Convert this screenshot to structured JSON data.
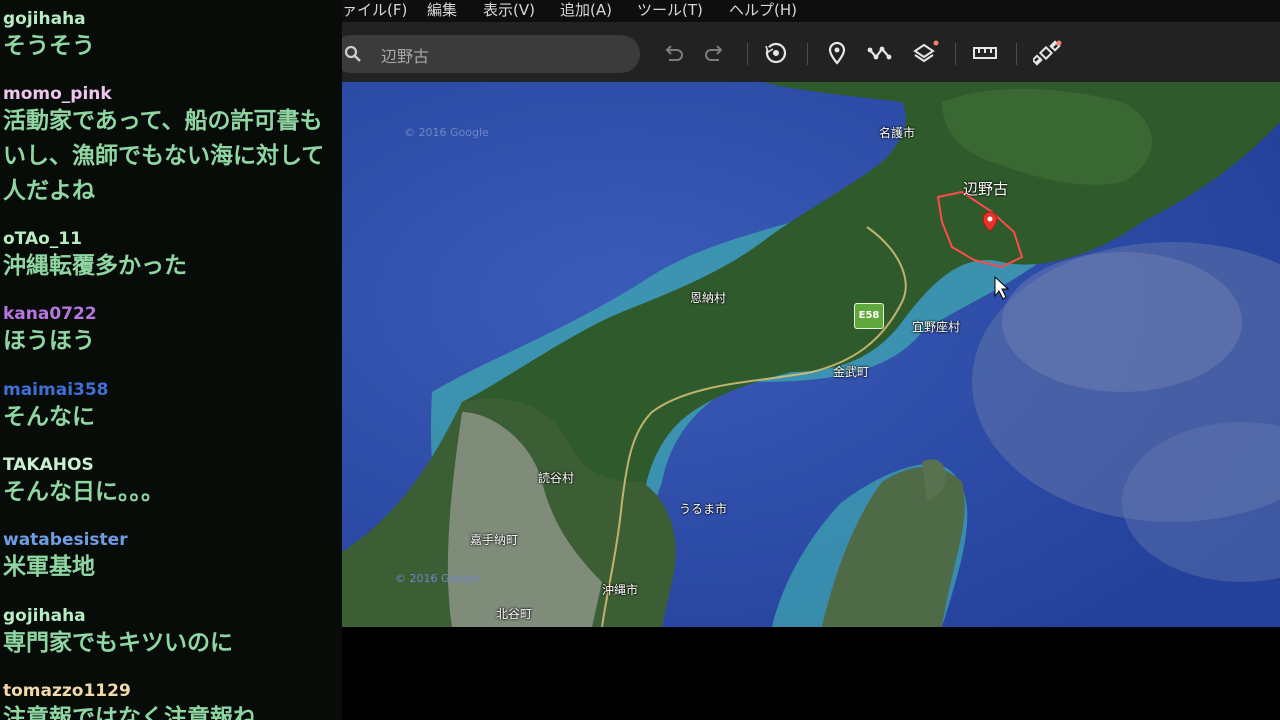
{
  "chat": {
    "messages": [
      {
        "user": "gojihaha",
        "user_color": "#b7ecc2",
        "lines": [
          "そうそう"
        ]
      },
      {
        "user": "momo_pink",
        "user_color": "#f0c6f0",
        "lines": [
          "活動家であって、船の許可書も",
          "いし、漁師でもない海に対して",
          "人だよね"
        ]
      },
      {
        "user": "oTAo_11",
        "user_color": "#b7ecc2",
        "lines": [
          "沖縄転覆多かった"
        ]
      },
      {
        "user": "kana0722",
        "user_color": "#b776e0",
        "lines": [
          "ほうほう"
        ]
      },
      {
        "user": "maimai358",
        "user_color": "#3f6fd6",
        "lines": [
          "そんなに"
        ]
      },
      {
        "user": "TAKAHOS",
        "user_color": "#c9f0d3",
        "lines": [
          "そんな日に。。。"
        ]
      },
      {
        "user": "watabesister",
        "user_color": "#6f9ce3",
        "lines": [
          "米軍基地"
        ]
      },
      {
        "user": "gojihaha",
        "user_color": "#b7ecc2",
        "lines": [
          "専門家でもキツいのに"
        ]
      },
      {
        "user": "tomazzo1129",
        "user_color": "#f1d9ab",
        "lines": [
          "注意報ではなく注意報ね"
        ]
      }
    ]
  },
  "app": {
    "menu": [
      "ァイル(F)",
      "編集",
      "表示(V)",
      "追加(A)",
      "ツール(T)",
      "ヘルプ(H)"
    ],
    "search": {
      "value": "辺野古"
    },
    "toolbar_icons": [
      "undo-icon",
      "redo-icon",
      "history-icon",
      "placemark-icon",
      "path-icon",
      "layers-icon",
      "ruler-icon",
      "satellite-icon"
    ]
  },
  "map": {
    "places": [
      "名護市",
      "辺野古",
      "恩納村",
      "宜野座村",
      "金武町",
      "読谷村",
      "うるま市",
      "嘉手納町",
      "沖縄市",
      "北谷町"
    ],
    "highway": "E58",
    "copyright": [
      "© 2016 Google",
      "© 2016 Google"
    ]
  },
  "colors": {
    "chat_text": "#8fd6a2",
    "marker": "#e8332a"
  }
}
